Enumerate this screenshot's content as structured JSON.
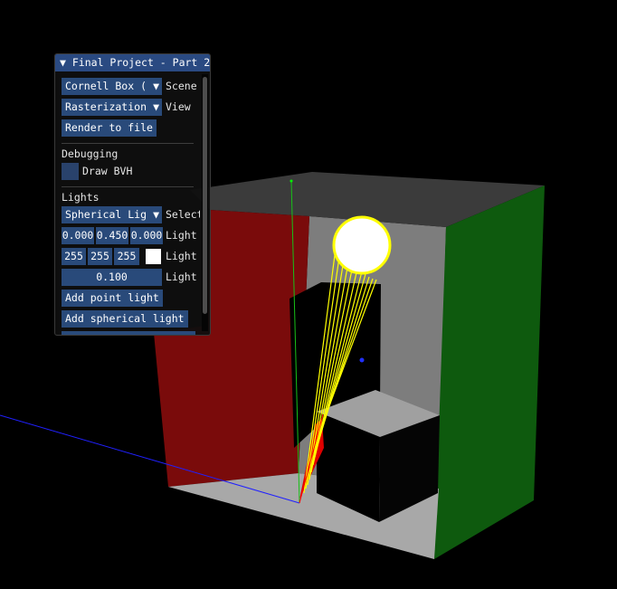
{
  "window": {
    "title": "Final Project - Part 2",
    "collapse_glyph": "▼"
  },
  "scene_controls": {
    "scene_select_value": "Cornell Box (",
    "scene_label": "Scene",
    "view_select_value": "Rasterization",
    "view_label": "View",
    "render_button": "Render to file"
  },
  "debugging": {
    "header": "Debugging",
    "draw_bvh_label": "Draw BVH",
    "draw_bvh_checked": false
  },
  "lights": {
    "header": "Lights",
    "light_select_value": "Spherical Lig",
    "select_label": "Select",
    "position": [
      "0.000",
      "0.450",
      "0.000"
    ],
    "position_label": "Light",
    "color": [
      "255",
      "255",
      "255"
    ],
    "color_swatch": "#ffffff",
    "color_label": "Light",
    "radius": "0.100",
    "radius_label": "Light",
    "add_point_button": "Add point light",
    "add_spherical_button": "Add spherical light"
  },
  "colors": {
    "title_bar": "#2a4a82",
    "widget": "#294a7a",
    "wall_left": "#7a0c0c",
    "wall_right": "#0f5a0f",
    "wall_back": "#808080",
    "floor": "#a6a6a6",
    "light": "#ffffff",
    "light_outline": "#ffff00"
  },
  "icons": {
    "dropdown": "chevron-down-icon",
    "collapse": "triangle-down-icon"
  }
}
